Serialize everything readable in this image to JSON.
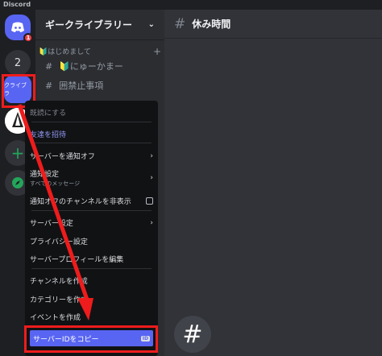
{
  "app_title": "Discord",
  "rail": {
    "dm_badge": "1",
    "server_two_label": "2",
    "active_server_label": "クライブラ",
    "add_symbol": "+"
  },
  "sidebar": {
    "server_name": "ギークライブラリー",
    "category": "🔰はじめまして",
    "channels": [
      {
        "name": "🔰にゅーかまー"
      },
      {
        "name": "囲禁止事項"
      }
    ]
  },
  "main": {
    "channel_name": "休み時間",
    "hash": "#"
  },
  "context_menu": {
    "mark_read": "既読にする",
    "invite": "友達を招待",
    "mute_server": "サーバーを通知オフ",
    "notification_settings": "通知設定",
    "notification_sub": "すべてのメッセージ",
    "hide_muted": "通知オフのチャンネルを非表示",
    "server_settings": "サーバー設定",
    "privacy_settings": "プライバシー設定",
    "edit_profile": "サーバープロフィールを編集",
    "create_channel": "チャンネルを作成",
    "create_category": "カテゴリーを作成",
    "create_event": "イベントを作成",
    "copy_server_id": "サーバーIDをコピー",
    "id_tag": "ID"
  },
  "colors": {
    "accent": "#5865f2",
    "annotation": "#ee1c1c"
  }
}
